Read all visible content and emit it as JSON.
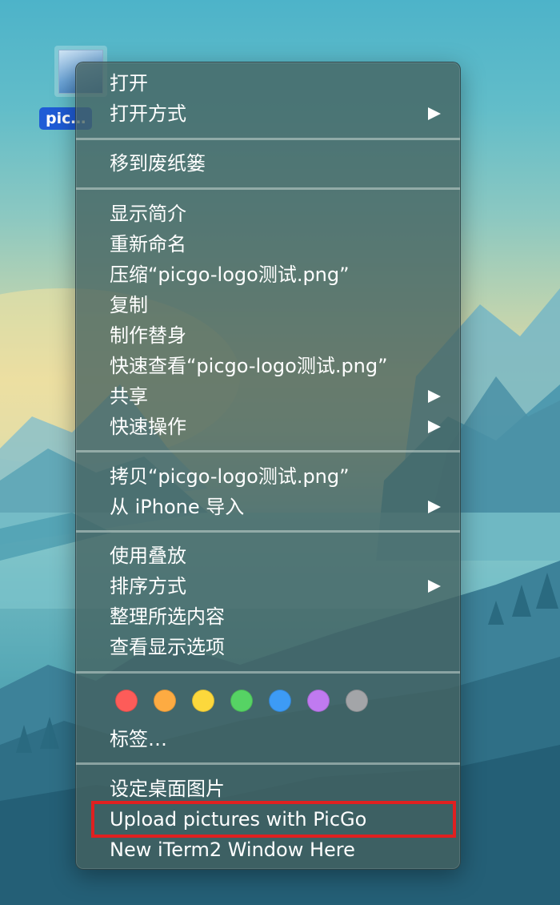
{
  "desktop": {
    "file_label": "pic…"
  },
  "menu": {
    "groups": [
      [
        {
          "label": "打开",
          "submenu": false
        },
        {
          "label": "打开方式",
          "submenu": true
        }
      ],
      [
        {
          "label": "移到废纸篓",
          "submenu": false
        }
      ],
      [
        {
          "label": "显示简介",
          "submenu": false
        },
        {
          "label": "重新命名",
          "submenu": false
        },
        {
          "label": "压缩“picgo-logo测试.png”",
          "submenu": false
        },
        {
          "label": "复制",
          "submenu": false
        },
        {
          "label": "制作替身",
          "submenu": false
        },
        {
          "label": "快速查看“picgo-logo测试.png”",
          "submenu": false
        },
        {
          "label": "共享",
          "submenu": true
        },
        {
          "label": "快速操作",
          "submenu": true
        }
      ],
      [
        {
          "label": "拷贝“picgo-logo测试.png”",
          "submenu": false
        },
        {
          "label": "从 iPhone 导入",
          "submenu": true
        }
      ],
      [
        {
          "label": "使用叠放",
          "submenu": false
        },
        {
          "label": "排序方式",
          "submenu": true
        },
        {
          "label": "整理所选内容",
          "submenu": false
        },
        {
          "label": "查看显示选项",
          "submenu": false
        }
      ]
    ],
    "tags": {
      "colors": [
        {
          "name": "red",
          "hex": "#fd5c59"
        },
        {
          "name": "orange",
          "hex": "#fdab42"
        },
        {
          "name": "yellow",
          "hex": "#fcd83c"
        },
        {
          "name": "green",
          "hex": "#56d364"
        },
        {
          "name": "blue",
          "hex": "#3d9bf5"
        },
        {
          "name": "purple",
          "hex": "#c07af0"
        },
        {
          "name": "gray",
          "hex": "#a3a5a8"
        }
      ],
      "label": "标签…"
    },
    "services": [
      {
        "label": "设定桌面图片",
        "submenu": false
      },
      {
        "label": "Upload pictures with PicGo",
        "submenu": false,
        "highlighted": true
      },
      {
        "label": "New iTerm2 Window Here",
        "submenu": false
      }
    ]
  }
}
